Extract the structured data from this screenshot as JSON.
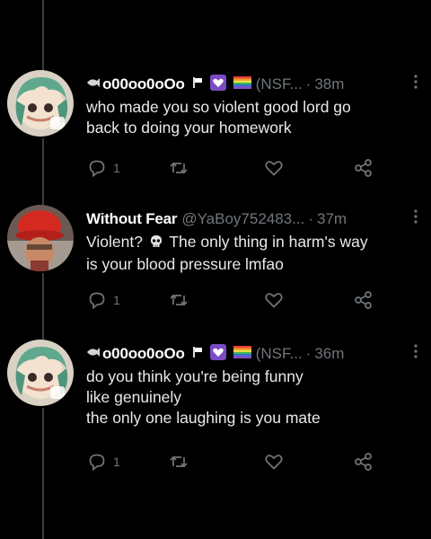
{
  "tweets": [
    {
      "display_name": "o00oo0oOo",
      "handle": "(NSF...",
      "dot": "·",
      "time": "38m",
      "lines": [
        "who made you so violent good lord go",
        "back to doing your homework"
      ],
      "reply_count": "1",
      "avatar": "green-hair-character",
      "badges": [
        "flag-icon",
        "purple-heart-icon",
        "rainbow-flag-icon"
      ]
    },
    {
      "display_name": "Without Fear",
      "handle": "@YaBoy752483...",
      "dot": "·",
      "time": "37m",
      "lines_pre": "Violent?",
      "lines_post": "The only thing in harm's way",
      "line2": "is your blood pressure lmfao",
      "reply_count": "1",
      "avatar": "red-hat-character"
    },
    {
      "display_name": "o00oo0oOo",
      "handle": "(NSF...",
      "dot": "·",
      "time": "36m",
      "lines": [
        "do you think you're being funny",
        "like genuinely",
        "the only one laughing is you mate"
      ],
      "reply_count": "1",
      "avatar": "green-hair-character",
      "badges": [
        "flag-icon",
        "purple-heart-icon",
        "rainbow-flag-icon"
      ]
    }
  ],
  "colors": {
    "background": "#000000",
    "text": "#e7e9ea",
    "muted": "#71767b",
    "thread_line": "#3a3d41"
  }
}
